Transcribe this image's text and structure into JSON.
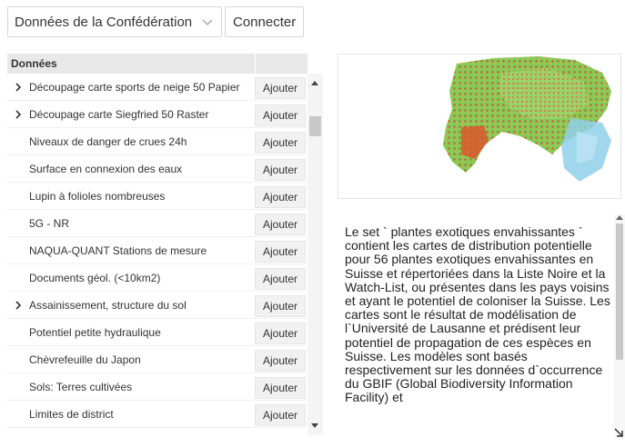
{
  "topbar": {
    "dataset_select": "Données de la Confédération",
    "connect_label": "Connecter"
  },
  "data_panel": {
    "header": "Données",
    "add_label": "Ajouter",
    "rows": [
      {
        "label": "Découpage carte sports de neige 50 Papier",
        "expandable": true
      },
      {
        "label": "Découpage carte Siegfried 50 Raster",
        "expandable": true
      },
      {
        "label": "Niveaux de danger de crues 24h",
        "expandable": false
      },
      {
        "label": "Surface en connexion des eaux",
        "expandable": false
      },
      {
        "label": "Lupin à folioles nombreuses",
        "expandable": false
      },
      {
        "label": "5G - NR",
        "expandable": false
      },
      {
        "label": "NAQUA-QUANT Stations de mesure",
        "expandable": false
      },
      {
        "label": "Documents géol. (<10km2)",
        "expandable": false
      },
      {
        "label": "Assainissement, structure du sol",
        "expandable": true
      },
      {
        "label": "Potentiel petite hydraulique",
        "expandable": false
      },
      {
        "label": "Chèvrefeuille du Japon",
        "expandable": false
      },
      {
        "label": "Sols: Terres cultivées",
        "expandable": false
      },
      {
        "label": "Limites de district",
        "expandable": false
      }
    ]
  },
  "description": {
    "text": "Le set ` plantes exotiques envahissantes ` contient les cartes de distribution potentielle pour 56 plantes exotiques envahissantes en Suisse et répertoriées dans la Liste Noire et la Watch-List, ou présentes dans les pays voisins et ayant le potentiel de coloniser la Suisse. Les cartes sont le résultat de modélisation de l`Université de Lausanne et prédisent leur potentiel de propagation de ces espèces en Suisse. Les modèles sont basés respectivement sur les données d`occurrence du GBIF (Global Biodiversity Information Facility) et"
  },
  "icons": {
    "select_chevron": "chevron-down-icon",
    "expand": "chevron-right-icon",
    "resize": "resize-diagonal-icon"
  },
  "colors": {
    "header_bg": "#e8e8e8",
    "button_bg": "#f1f1f1",
    "map_red": "#e0502a",
    "map_green": "#7ccf5a",
    "map_blue": "#7fc5e4"
  }
}
